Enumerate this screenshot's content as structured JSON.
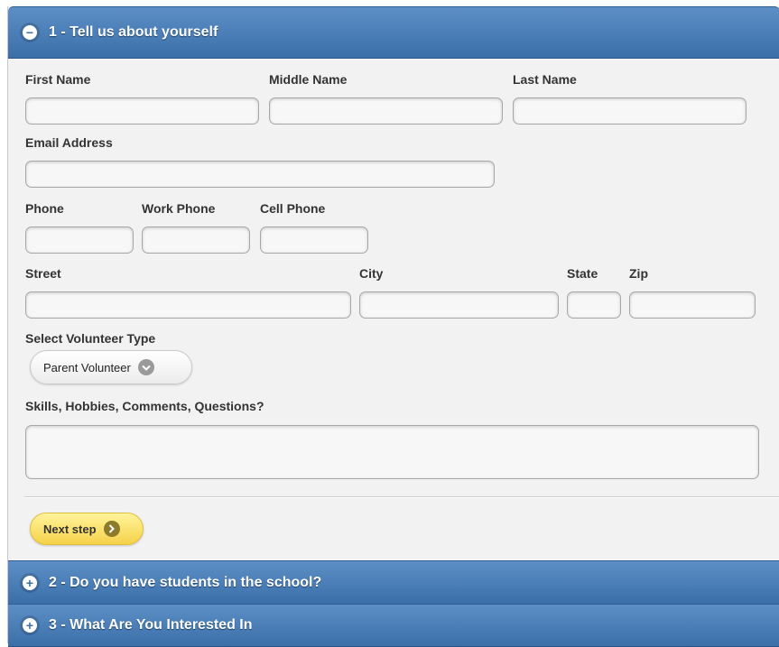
{
  "sections": [
    {
      "number_title": "1 - Tell us about yourself",
      "toggle": "−",
      "toggle_icon": "minus-icon"
    },
    {
      "number_title": "2 - Do you have students in the school?",
      "toggle": "+",
      "toggle_icon": "plus-icon"
    },
    {
      "number_title": "3 - What Are You Interested In",
      "toggle": "+",
      "toggle_icon": "plus-icon"
    }
  ],
  "form": {
    "first_name": {
      "label": "First Name",
      "value": ""
    },
    "middle_name": {
      "label": "Middle Name",
      "value": ""
    },
    "last_name": {
      "label": "Last Name",
      "value": ""
    },
    "email": {
      "label": "Email Address",
      "value": ""
    },
    "phone": {
      "label": "Phone",
      "value": ""
    },
    "work_phone": {
      "label": "Work Phone",
      "value": ""
    },
    "cell_phone": {
      "label": "Cell Phone",
      "value": ""
    },
    "street": {
      "label": "Street",
      "value": ""
    },
    "city": {
      "label": "City",
      "value": ""
    },
    "state": {
      "label": "State",
      "value": ""
    },
    "zip": {
      "label": "Zip",
      "value": ""
    },
    "volunteer_type": {
      "label": "Select Volunteer Type",
      "selected": "Parent Volunteer",
      "icon": "chevron-down-icon"
    },
    "comments": {
      "label": "Skills, Hobbies, Comments, Questions?",
      "value": ""
    }
  },
  "next_button": {
    "label": "Next step",
    "icon": "arrow-right-icon"
  },
  "colors": {
    "header_top": "#5d8fc6",
    "header_bottom": "#3b6fa8",
    "next_button": "#f6d24a",
    "panel_bg": "#f2f2f2"
  }
}
